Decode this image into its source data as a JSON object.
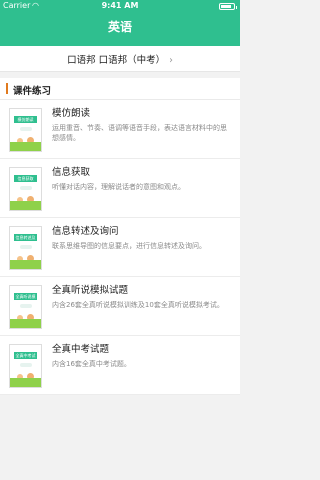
{
  "status_bar": {
    "carrier": "Carrier",
    "wifi_icon": "wifi-icon",
    "time": "9:41 AM",
    "battery_level": 0.8
  },
  "header": {
    "title": "英语"
  },
  "breadcrumb": {
    "text": "口语邦 口语邦（中考）",
    "chevron": "›"
  },
  "section": {
    "title": "课件练习"
  },
  "courses": [
    {
      "thumb_label": "模仿朗读",
      "name": "模仿朗读",
      "desc": "运用重音、节奏、语调等语音手段，表达语言材料中的思想感情。"
    },
    {
      "thumb_label": "信息获取",
      "name": "信息获取",
      "desc": "听懂对话内容，理解说话者的意图和观点。"
    },
    {
      "thumb_label": "信息转述及询问",
      "name": "信息转述及询问",
      "desc": "联系思维导图的信息要点，进行信息转述及询问。"
    },
    {
      "thumb_label": "全真听说模拟试题",
      "name": "全真听说模拟试题",
      "desc": "内含26套全真听说模拟训练及10套全真听说模拟考试。"
    },
    {
      "thumb_label": "全真中考试题",
      "name": "全真中考试题",
      "desc": "内含16套全真中考试题。"
    }
  ]
}
